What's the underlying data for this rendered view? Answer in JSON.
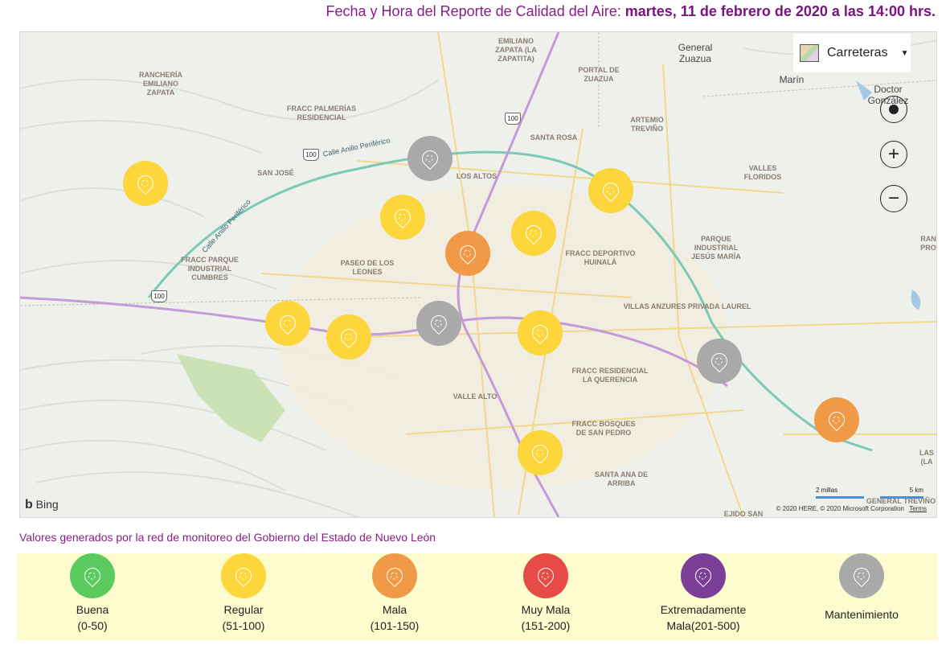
{
  "header": {
    "prefix": "Fecha y Hora del Reporte de Calidad del Aire:",
    "datetime": "martes, 11 de febrero de 2020 a las 14:00 hrs."
  },
  "colors": {
    "buena": "#5ccb5f",
    "regular": "#fcd63a",
    "mala": "#f09a47",
    "muy_mala": "#e64b47",
    "extremadamente_mala": "#7b3f98",
    "mantenimiento": "#a9a9a9"
  },
  "map": {
    "style_selector": "Carreteras",
    "bing_label": "Bing",
    "copyright": "© 2020 HERE, © 2020 Microsoft Corporation",
    "terms": "Terms",
    "scale_miles": "2 millas",
    "scale_km": "5 km",
    "places": {
      "ranch_zapata": "RANCHERÍA\nEMILIANO\nZAPATA",
      "emiliano_zapata": "EMILIANO\nZAPATA (LA\nZAPATITA)",
      "general_zuazua": "General\nZuazua",
      "marin": "Marín",
      "doctor_gonzalez": "Doctor\nGonzález",
      "portal_zuazua": "PORTAL DE\nZUAZUA",
      "palmerias": "FRACC PALMERÍAS\nRESIDENCIAL",
      "artemio": "ARTEMIO\nTREVIÑO",
      "santa_rosa": "SANTA ROSA",
      "san_jose": "SAN JOSÉ",
      "los_altos": "LOS ALTOS",
      "valles_floridos": "VALLES\nFLORIDOS",
      "parque_jesus_maria": "PARQUE\nINDUSTRIAL\nJESÚS MARÍA",
      "parque_cumbres": "FRACC PARQUE\nINDUSTRIAL\nCUMBRES",
      "paseo_leones": "PASEO DE LOS\nLEONES",
      "deportivo_huinala": "FRACC DEPORTIVO\nHUINALÁ",
      "villas_anzures": "VILLAS ANZURES PRIVADA LAUREL",
      "la_querencia": "FRACC RESIDENCIAL\nLA QUERENCIA",
      "valle_alto": "VALLE ALTO",
      "bosques_san_pedro": "FRACC BOSQUES\nDE SAN PEDRO",
      "santa_ana_arriba": "SANTA ANA DE\nARRIBA",
      "general_trevino": "GENERAL TREVIÑO",
      "ejido_san": "EJIDO SAN",
      "ran_edge": "RAN\nPRO",
      "las_edge": "LAS\n(LA"
    },
    "road_labels": {
      "anillo_top": "Calle Anillo Periférico",
      "anillo_left": "Calle Anillo Periférico"
    },
    "highway_shields": [
      "100",
      "100",
      "100"
    ],
    "stations": [
      {
        "status": "regular",
        "color": "#fcd63a"
      },
      {
        "status": "mantenimiento",
        "color": "#a9a9a9"
      },
      {
        "status": "regular",
        "color": "#fcd63a"
      },
      {
        "status": "regular",
        "color": "#fcd63a"
      },
      {
        "status": "mala",
        "color": "#f09a47"
      },
      {
        "status": "regular",
        "color": "#fcd63a"
      },
      {
        "status": "regular",
        "color": "#fcd63a"
      },
      {
        "status": "regular",
        "color": "#fcd63a"
      },
      {
        "status": "mantenimiento",
        "color": "#a9a9a9"
      },
      {
        "status": "regular",
        "color": "#fcd63a"
      },
      {
        "status": "mantenimiento",
        "color": "#a9a9a9"
      },
      {
        "status": "mala",
        "color": "#f09a47"
      },
      {
        "status": "regular",
        "color": "#fcd63a"
      }
    ]
  },
  "note": "Valores generados por la red de monitoreo del Gobierno del Estado de Nuevo León",
  "legend": [
    {
      "label": "Buena",
      "range": "(0-50)",
      "color": "#5ccb5f"
    },
    {
      "label": "Regular",
      "range": "(51-100)",
      "color": "#fcd63a"
    },
    {
      "label": "Mala",
      "range": "(101-150)",
      "color": "#f09a47"
    },
    {
      "label": "Muy Mala",
      "range": "(151-200)",
      "color": "#e64b47"
    },
    {
      "label": "Extremadamente",
      "range": "Mala(201-500)",
      "color": "#7b3f98"
    },
    {
      "label": "Mantenimiento",
      "range": "",
      "color": "#a9a9a9"
    }
  ]
}
